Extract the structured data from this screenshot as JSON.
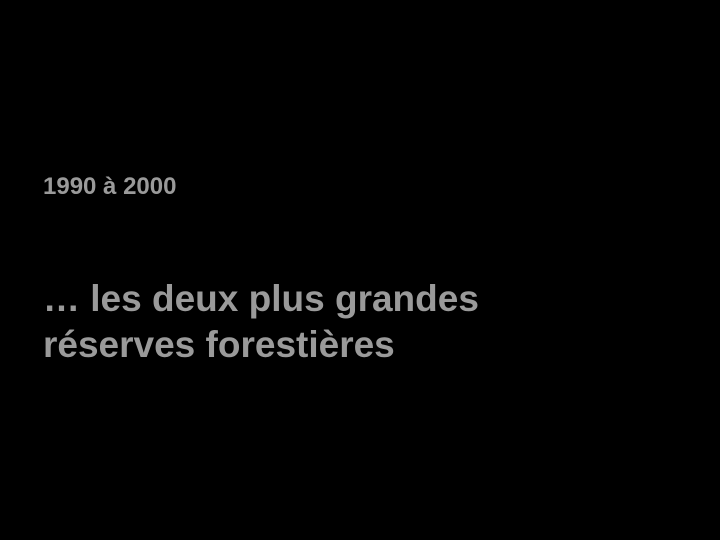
{
  "slide": {
    "date_range": "1990 à 2000",
    "headline_line1": "… les deux plus grandes",
    "headline_line2": "réserves forestières"
  },
  "colors": {
    "background": "#000000",
    "text": "#9a9a9a"
  }
}
